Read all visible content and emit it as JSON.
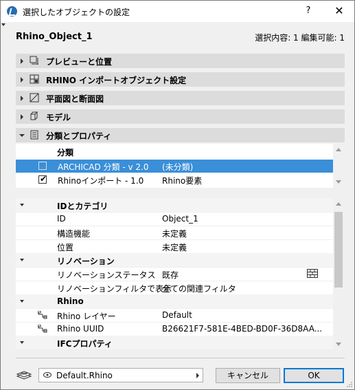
{
  "window": {
    "title": "選択したオブジェクトの設定",
    "help": "?",
    "close": "✕"
  },
  "header": {
    "object_name": "Rhino_Object_1",
    "selection_info": "選択内容: 1 編集可能: 1"
  },
  "sections": [
    {
      "label": "プレビューと位置",
      "icon": "preview-position-icon",
      "expanded": false
    },
    {
      "label": "RHINO インポートオブジェクト設定",
      "icon": "import-settings-icon",
      "expanded": false
    },
    {
      "label": "平面図と断面図",
      "icon": "floor-plan-section-icon",
      "expanded": false
    },
    {
      "label": "モデル",
      "icon": "model-cube-icon",
      "expanded": false
    },
    {
      "label": "分類とプロパティ",
      "icon": "classification-document-icon",
      "expanded": true
    }
  ],
  "classification": {
    "header": "分類",
    "rows": [
      {
        "name": "ARCHICAD 分類 - v 2.0",
        "value": "(未分類)",
        "checked": false,
        "selected": true
      },
      {
        "name": "Rhinoインポート - 1.0",
        "value": "Rhino要素",
        "checked": true,
        "selected": false
      }
    ]
  },
  "properties": {
    "rows": [
      {
        "type": "group",
        "label": "IDとカテゴリ"
      },
      {
        "type": "item",
        "name": "ID",
        "value": "Object_1"
      },
      {
        "type": "item",
        "name": "構造機能",
        "value": "未定義"
      },
      {
        "type": "item",
        "name": "位置",
        "value": "未定義"
      },
      {
        "type": "group",
        "label": "リノベーション"
      },
      {
        "type": "item",
        "name": "リノベーションステータス",
        "value": "既存",
        "icon": "brick-wall-icon"
      },
      {
        "type": "item",
        "name": "リノベーションフィルタで表示",
        "value": "全ての関連フィルタ"
      },
      {
        "type": "group",
        "label": "Rhino"
      },
      {
        "type": "linked",
        "name": "Rhino レイヤー",
        "value": "Default",
        "icon": "link-icon"
      },
      {
        "type": "linked",
        "name": "Rhino UUID",
        "value": "B26621F7-581E-4BED-BD0F-36D8AA...",
        "icon": "link-icon"
      },
      {
        "type": "group",
        "label": "IFCプロパティ"
      }
    ]
  },
  "footer": {
    "layer_value": "Default.Rhino",
    "cancel_label": "キャンセル",
    "ok_label": "OK"
  },
  "colors": {
    "selection_blue": "#3a8fd8",
    "ok_border": "#0078d7",
    "section_bg": "#dcdcdc"
  }
}
